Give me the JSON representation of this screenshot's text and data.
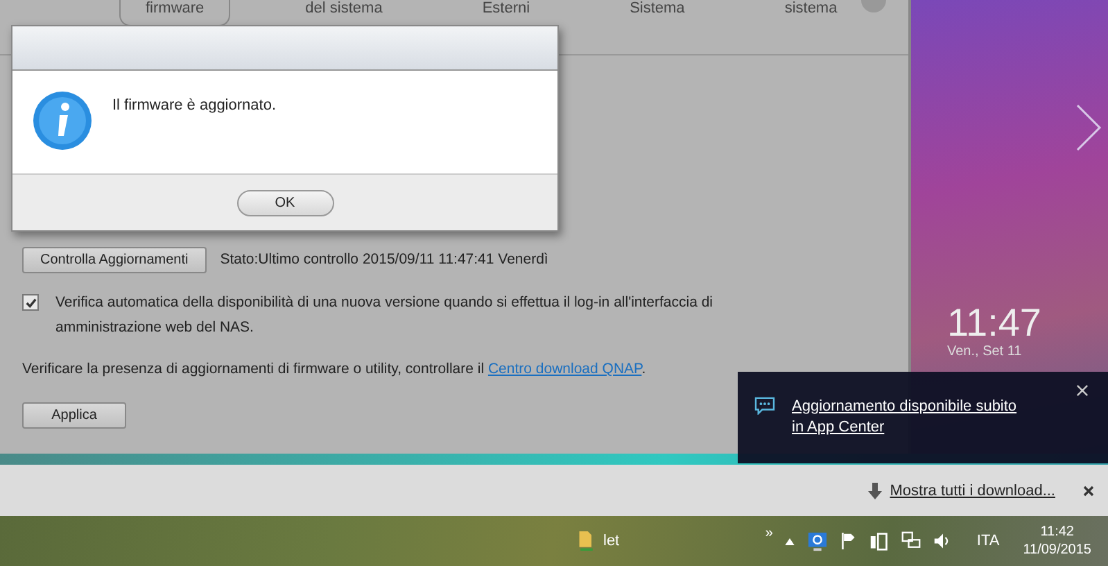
{
  "tabs": [
    {
      "label": "firmware",
      "selected": true
    },
    {
      "label": "del sistema",
      "selected": false
    },
    {
      "label": "Esterni",
      "selected": false
    },
    {
      "label": "Sistema",
      "selected": false
    },
    {
      "label": "sistema",
      "selected": false
    }
  ],
  "dialog": {
    "message": "Il firmware è aggiornato.",
    "button": "OK"
  },
  "update": {
    "check_button": "Controlla Aggiornamenti",
    "status": "Stato:Ultimo controllo 2015/09/11 11:47:41 Venerdì",
    "auto_check": {
      "label": "Verifica automatica della disponibilità di una nuova versione quando si effettua il log-in all'interfaccia di amministrazione web del NAS.",
      "checked": true
    },
    "note": "Verificare la presenza di aggiornamenti di firmware o utility, controllare il ",
    "link": "Centro download QNAP",
    "note_end": ".",
    "apply_button": "Applica"
  },
  "side_panel": {
    "clock": "11:47",
    "date": "Ven., Set 11"
  },
  "toast": {
    "message": "Aggiornamento disponibile subito in App Center"
  },
  "download_bar": {
    "link": "Mostra tutti i download..."
  },
  "taskbar": {
    "desktop_item": "let",
    "overflow": "»",
    "language": "ITA",
    "time": "11:42",
    "date": "11/09/2015"
  }
}
